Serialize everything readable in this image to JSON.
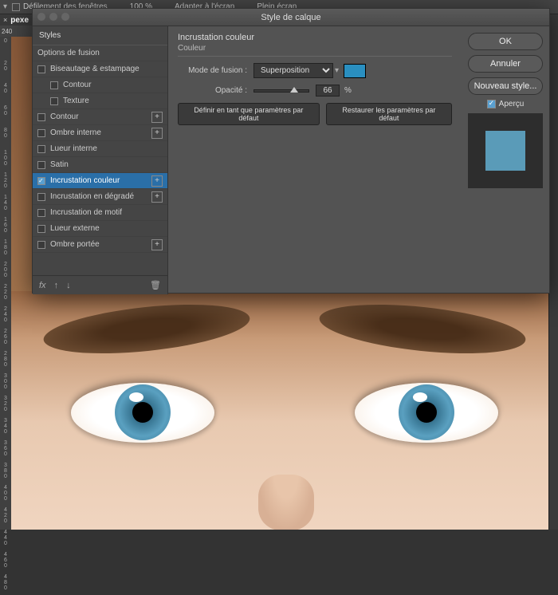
{
  "topbar": {
    "scroll_label": "Défilement des fenêtres",
    "zoom": "100 %",
    "fit": "Adapter à l'écran",
    "full": "Plein écran"
  },
  "tab": {
    "name": "pexe"
  },
  "ruler_start": "240",
  "left_ticks": [
    "0",
    "20",
    "40",
    "60",
    "80",
    "100",
    "120",
    "140",
    "160",
    "180",
    "200",
    "220",
    "240",
    "260",
    "280",
    "300",
    "320",
    "340",
    "360",
    "380",
    "400",
    "420",
    "440",
    "460",
    "480"
  ],
  "dialog": {
    "title": "Style de calque",
    "styles_header": "Styles",
    "blend_options": "Options de fusion",
    "items": [
      {
        "label": "Biseautage & estampage",
        "sub": false,
        "plus": false
      },
      {
        "label": "Contour",
        "sub": true,
        "plus": false
      },
      {
        "label": "Texture",
        "sub": true,
        "plus": false
      },
      {
        "label": "Contour",
        "sub": false,
        "plus": true
      },
      {
        "label": "Ombre interne",
        "sub": false,
        "plus": true
      },
      {
        "label": "Lueur interne",
        "sub": false,
        "plus": false
      },
      {
        "label": "Satin",
        "sub": false,
        "plus": false
      },
      {
        "label": "Incrustation couleur",
        "sub": false,
        "plus": true,
        "active": true,
        "checked": true
      },
      {
        "label": "Incrustation en dégradé",
        "sub": false,
        "plus": true
      },
      {
        "label": "Incrustation de motif",
        "sub": false,
        "plus": false
      },
      {
        "label": "Lueur externe",
        "sub": false,
        "plus": false
      },
      {
        "label": "Ombre portée",
        "sub": false,
        "plus": true
      }
    ],
    "fx_label": "fx",
    "settings": {
      "section": "Incrustation couleur",
      "subsection": "Couleur",
      "blend_mode_label": "Mode de fusion :",
      "blend_mode_value": "Superposition",
      "opacity_label": "Opacité :",
      "opacity_value": "66",
      "opacity_unit": "%",
      "make_default": "Définir en tant que paramètres par défaut",
      "reset_default": "Restaurer les paramètres par défaut",
      "swatch_color": "#2a8fc0"
    },
    "buttons": {
      "ok": "OK",
      "cancel": "Annuler",
      "new_style": "Nouveau style...",
      "preview": "Aperçu"
    }
  }
}
